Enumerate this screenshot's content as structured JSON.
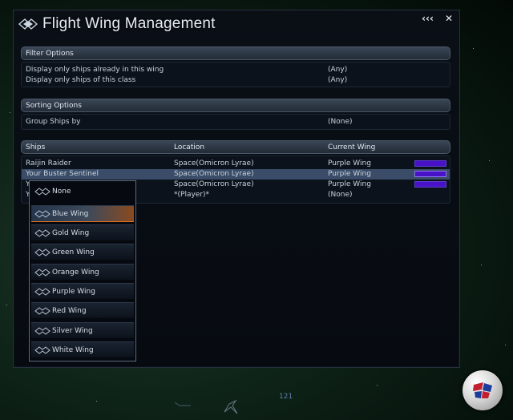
{
  "window": {
    "title": "Flight Wing Management",
    "controls": {
      "collapse": "‹‹‹",
      "close": "✕"
    }
  },
  "filter": {
    "header": "Filter Options",
    "rows": [
      {
        "label": "Display only ships already in this wing",
        "value": "(Any)"
      },
      {
        "label": "Display only ships of this class",
        "value": "(Any)"
      }
    ]
  },
  "sorting": {
    "header": "Sorting Options",
    "rows": [
      {
        "label": "Group Ships by",
        "value": "(None)"
      }
    ]
  },
  "ships": {
    "columns": {
      "ship": "Ships",
      "location": "Location",
      "wing": "Current Wing"
    },
    "rows": [
      {
        "ship": "Raijin Raider",
        "location": "Space(Omicron Lyrae)",
        "wing": "Purple Wing",
        "wing_color": "#4a12c8"
      },
      {
        "ship": "Your Buster Sentinel",
        "location": "Space(Omicron Lyrae)",
        "wing": "Purple Wing",
        "wing_color": "#4a12c8"
      },
      {
        "ship": "Y",
        "location": "Space(Omicron Lyrae)",
        "wing": "Purple Wing",
        "wing_color": "#4a12c8"
      },
      {
        "ship": "Y",
        "location": "*(Player)*",
        "wing": "(None)",
        "wing_color": ""
      }
    ]
  },
  "dropdown": {
    "items": [
      "None",
      "Blue Wing",
      "Gold Wing",
      "Green Wing",
      "Orange Wing",
      "Purple Wing",
      "Red Wing",
      "Silver Wing",
      "White Wing"
    ],
    "highlighted": "Blue Wing"
  },
  "hud": {
    "number": "121"
  },
  "colors": {
    "accent": "#e07020",
    "purple_wing": "#4a12c8",
    "selection": "#3a4c68"
  }
}
